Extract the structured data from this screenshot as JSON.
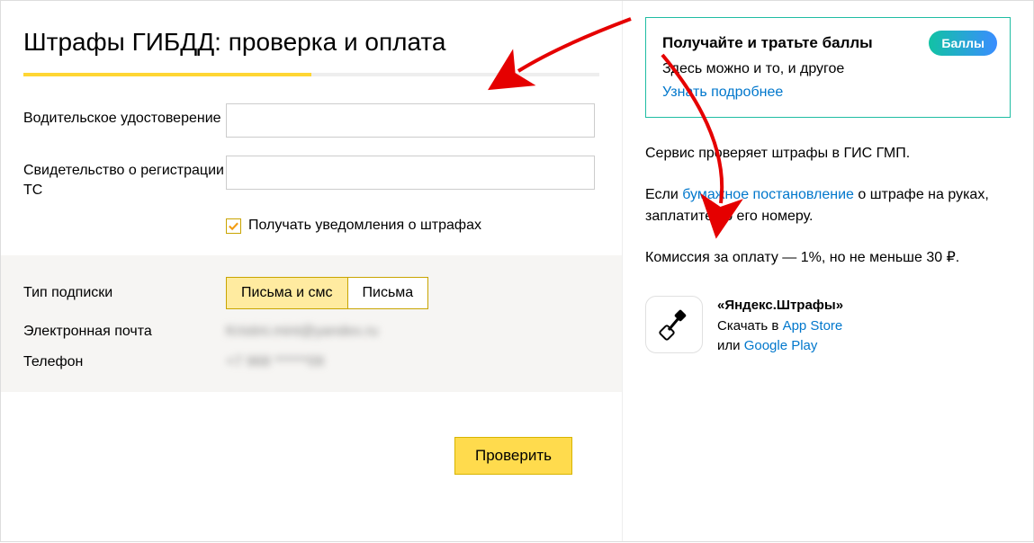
{
  "page_title": "Штрафы ГИБДД: проверка и оплата",
  "form": {
    "license_label": "Водительское удостоверение",
    "registration_label": "Свидетельство о регистрации ТС",
    "notify_checkbox_label": "Получать уведомления о штрафах",
    "notify_checked": true,
    "subscription_label": "Тип подписки",
    "toggle_option_active": "Письма и смс",
    "toggle_option_inactive": "Письма",
    "email_label": "Электронная почта",
    "email_value": "Kristini.mint@yandex.ru",
    "phone_label": "Телефон",
    "phone_value": "+7 968 ******09",
    "submit_label": "Проверить"
  },
  "promo": {
    "title": "Получайте и тратьте баллы",
    "subtitle": "Здесь можно и то, и другое",
    "link_text": "Узнать подробнее",
    "badge": "Баллы"
  },
  "info": {
    "line1": "Сервис проверяет штрафы в ГИС ГМП.",
    "line2_before": "Если ",
    "line2_link": "бумажное постановление",
    "line2_after": " о штрафе на руках, заплатите по его номеру.",
    "line3": "Комиссия за оплату — 1%, но не меньше 30 ₽."
  },
  "app": {
    "name": "«Яндекс.Штрафы»",
    "download_prefix": "Скачать в ",
    "store1": "App Store",
    "or": "или ",
    "store2": "Google Play"
  }
}
